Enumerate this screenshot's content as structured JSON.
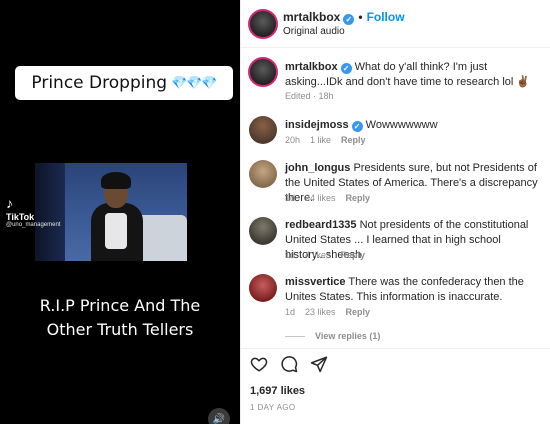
{
  "video": {
    "caption_top": "Prince Dropping",
    "caption_top_emoji": "💎💎💎",
    "tiktok_brand": "TikTok",
    "tiktok_handle": "@uno_management",
    "caption_bottom_line1": "R.I.P Prince And The",
    "caption_bottom_line2": "Other Truth Tellers",
    "sound_icon": "🔊"
  },
  "header": {
    "username": "mrtalkbox",
    "follow_label": "Follow",
    "audio_label": "Original audio"
  },
  "caption": {
    "username": "mrtalkbox",
    "text": "What do y'all think? I'm just asking...IDk and don't have time to research lol ✌🏾",
    "meta": "Edited · 18h"
  },
  "comments": [
    {
      "username": "insidejmoss",
      "verified": true,
      "text": "Wowwwwwww",
      "time": "20h",
      "likes": "1 like",
      "reply": "Reply"
    },
    {
      "username": "john_longus",
      "verified": false,
      "text": "Presidents sure, but not Presidents of the United States of America. There's a discrepancy there.",
      "time": "1d",
      "likes": "24 likes",
      "reply": "Reply"
    },
    {
      "username": "redbeard1335",
      "verified": false,
      "text": "Not presidents of the constitutional United States ... I learned that in high school history...sheesh",
      "time": "1d",
      "likes": "4 likes",
      "reply": "Reply"
    },
    {
      "username": "missvertice",
      "verified": false,
      "text": "There was the confederacy then the Unites States. This information is inaccurate.",
      "time": "1d",
      "likes": "23 likes",
      "reply": "Reply"
    }
  ],
  "view_replies": "View replies (1)",
  "footer": {
    "likes": "1,697 likes",
    "time": "1 DAY AGO"
  },
  "icons": {
    "verified": "✓",
    "like": "heart-icon",
    "comment": "comment-icon",
    "share": "share-icon"
  },
  "colors": {
    "follow": "#0095f6",
    "verified": "#3897f0",
    "muted": "#8e8e8e"
  }
}
